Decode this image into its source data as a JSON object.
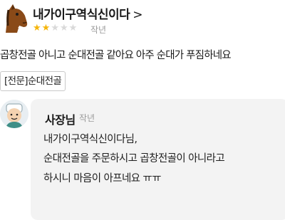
{
  "review": {
    "reviewer_name": "내가이구역식신이다",
    "chevron": ">",
    "rating": 2,
    "rating_max": 5,
    "date": "작년",
    "text": "곱창전골 아니고 순대전골 같아요 아주 순대가 푸짐하네요",
    "menu_tag": "[전문]순대전골"
  },
  "reply": {
    "owner_name": "사장님",
    "date": "작년",
    "lines": [
      "내가이구역식신이다님,",
      "순대전골을 주문하시고 곱창전골이 아니라고",
      "하시니 마음이 아프네요 ㅠㅠ"
    ]
  },
  "colors": {
    "star_filled": "#f5b50a",
    "star_empty": "#d9d9d9",
    "reply_background": "#f3f3f3"
  }
}
